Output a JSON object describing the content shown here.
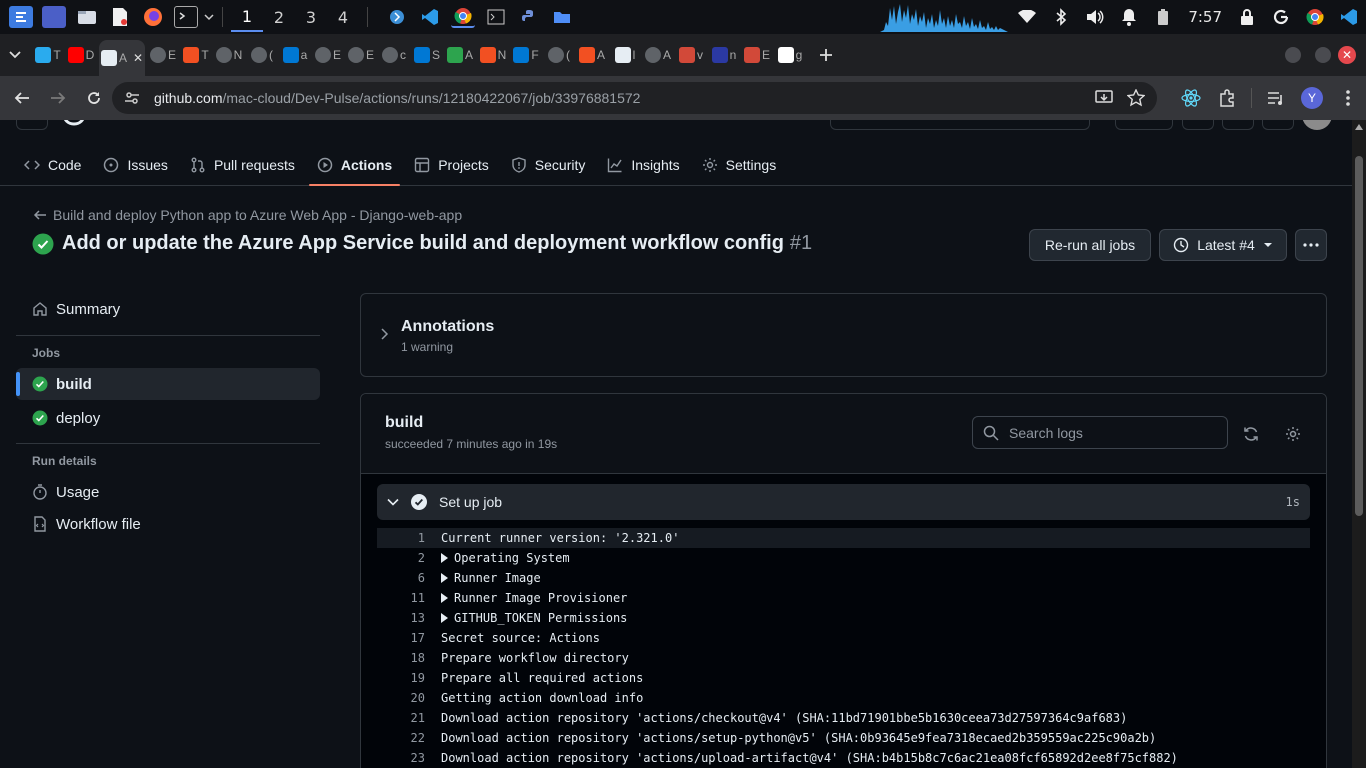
{
  "taskbar": {
    "workspaces": [
      "1",
      "2",
      "3",
      "4"
    ],
    "active_workspace": "1",
    "clock": "7:57",
    "launcher_icons": [
      "kde-launcher-icon",
      "desktop-icon",
      "file-manager-icon",
      "text-editor-icon",
      "firefox-icon",
      "terminal-icon"
    ],
    "pinned_apps": [
      "azure-data-studio-icon",
      "vscode-icon",
      "chrome-icon",
      "terminal-icon",
      "python-icon",
      "folder-icon"
    ],
    "tray_icons": [
      "wifi-icon",
      "bluetooth-icon",
      "volume-icon",
      "notification-icon",
      "battery-icon"
    ],
    "right_icons": [
      "lock-icon",
      "google-icon",
      "chrome-icon",
      "vscode-icon"
    ]
  },
  "tabs": [
    {
      "icon": "telegram-icon",
      "frag": "T"
    },
    {
      "icon": "youtube-icon",
      "frag": "D"
    },
    {
      "icon": "github-active-icon",
      "frag": "A",
      "active": true
    },
    {
      "icon": "globe-icon",
      "frag": "E"
    },
    {
      "icon": "microsoft-icon",
      "frag": "T"
    },
    {
      "icon": "globe-icon",
      "frag": "N"
    },
    {
      "icon": "globe-icon",
      "frag": "("
    },
    {
      "icon": "azure-icon",
      "frag": "a"
    },
    {
      "icon": "globe-icon",
      "frag": "E"
    },
    {
      "icon": "globe-icon",
      "frag": "E"
    },
    {
      "icon": "globe-icon",
      "frag": "c"
    },
    {
      "icon": "azure-icon",
      "frag": "S"
    },
    {
      "icon": "github-check-icon",
      "frag": "A"
    },
    {
      "icon": "microsoft-icon",
      "frag": "N"
    },
    {
      "icon": "azure-icon",
      "frag": "F"
    },
    {
      "icon": "openai-icon",
      "frag": "("
    },
    {
      "icon": "microsoft-icon",
      "frag": "A"
    },
    {
      "icon": "github-icon",
      "frag": "l"
    },
    {
      "icon": "audio-icon",
      "frag": "A"
    },
    {
      "icon": "jenkins-icon",
      "frag": "v"
    },
    {
      "icon": "n-icon",
      "frag": "n"
    },
    {
      "icon": "jenkins-icon",
      "frag": "E"
    },
    {
      "icon": "google-icon",
      "frag": "g"
    }
  ],
  "address": {
    "host": "github.com",
    "path": "/mac-cloud/Dev-Pulse/actions/runs/12180422067/job/33976881572",
    "profile_initial": "Y"
  },
  "repo_nav": [
    {
      "label": "Code",
      "icon": "code-icon"
    },
    {
      "label": "Issues",
      "icon": "issue-icon"
    },
    {
      "label": "Pull requests",
      "icon": "pull-request-icon"
    },
    {
      "label": "Actions",
      "icon": "play-icon",
      "active": true
    },
    {
      "label": "Projects",
      "icon": "table-icon"
    },
    {
      "label": "Security",
      "icon": "shield-icon"
    },
    {
      "label": "Insights",
      "icon": "graph-icon"
    },
    {
      "label": "Settings",
      "icon": "gear-icon"
    }
  ],
  "run": {
    "workflow_link": "Build and deploy Python app to Azure Web App - Django-web-app",
    "title": "Add or update the Azure App Service build and deployment workflow config",
    "number": "#1",
    "rerun_label": "Re-run all jobs",
    "attempt_label": "Latest #4"
  },
  "sidebar": {
    "summary": "Summary",
    "jobs_heading": "Jobs",
    "jobs": [
      {
        "label": "build",
        "status": "success",
        "selected": true
      },
      {
        "label": "deploy",
        "status": "success"
      }
    ],
    "run_details_heading": "Run details",
    "usage": "Usage",
    "workflow_file": "Workflow file"
  },
  "annotations": {
    "title": "Annotations",
    "subtitle": "1 warning"
  },
  "job": {
    "name": "build",
    "meta": "succeeded 7 minutes ago in 19s",
    "search_placeholder": "Search logs",
    "step": {
      "label": "Set up job",
      "duration": "1s"
    },
    "log": [
      {
        "n": "1",
        "text": "Current runner version: '2.321.0'",
        "group": false
      },
      {
        "n": "2",
        "text": "Operating System",
        "group": true
      },
      {
        "n": "6",
        "text": "Runner Image",
        "group": true
      },
      {
        "n": "11",
        "text": "Runner Image Provisioner",
        "group": true
      },
      {
        "n": "13",
        "text": "GITHUB_TOKEN Permissions",
        "group": true
      },
      {
        "n": "17",
        "text": "Secret source: Actions",
        "group": false
      },
      {
        "n": "18",
        "text": "Prepare workflow directory",
        "group": false
      },
      {
        "n": "19",
        "text": "Prepare all required actions",
        "group": false
      },
      {
        "n": "20",
        "text": "Getting action download info",
        "group": false
      },
      {
        "n": "21",
        "text": "Download action repository 'actions/checkout@v4' (SHA:11bd71901bbe5b1630ceea73d27597364c9af683)",
        "group": false
      },
      {
        "n": "22",
        "text": "Download action repository 'actions/setup-python@v5' (SHA:0b93645e9fea7318ecaed2b359559ac225c90a2b)",
        "group": false
      },
      {
        "n": "23",
        "text": "Download action repository 'actions/upload-artifact@v4' (SHA:b4b15b8c7c6ac21ea08fcf65892d2ee8f75cf882)",
        "group": false
      }
    ]
  },
  "colors": {
    "accent_tab_underline": "#f78166",
    "success_green": "#2da44e",
    "selected_bar": "#4493f8"
  }
}
